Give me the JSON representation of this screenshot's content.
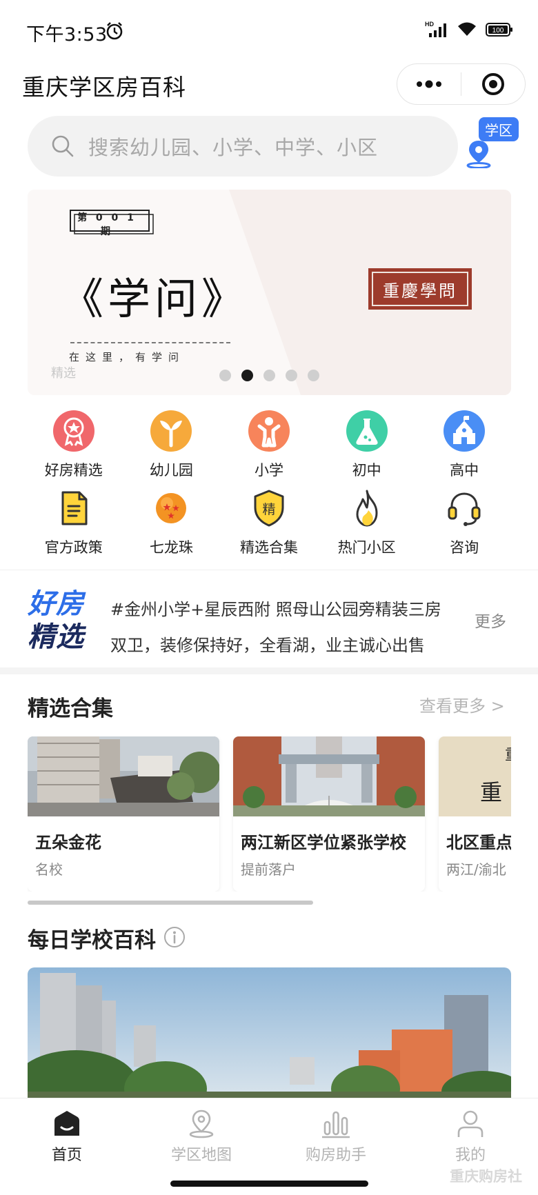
{
  "status_bar": {
    "time": "下午3:53",
    "network_label": "HD",
    "battery": "100"
  },
  "header": {
    "title": "重庆学区房百科"
  },
  "search": {
    "placeholder": "搜索幼儿园、小学、中学、小区",
    "district_badge": "学区"
  },
  "banner": {
    "issue": "第 0 0 1 期",
    "title": "《学问》",
    "subtitle": "在这里，有学问",
    "tag": "精选",
    "seal": "重慶學問",
    "dots_total": 5,
    "active_dot": 2
  },
  "categories": [
    {
      "label": "好房精选",
      "icon": "medal-icon"
    },
    {
      "label": "幼儿园",
      "icon": "sprout-icon"
    },
    {
      "label": "小学",
      "icon": "child-icon"
    },
    {
      "label": "初中",
      "icon": "flask-icon"
    },
    {
      "label": "高中",
      "icon": "school-icon"
    },
    {
      "label": "官方政策",
      "icon": "document-icon"
    },
    {
      "label": "七龙珠",
      "icon": "dragon-ball-icon"
    },
    {
      "label": "精选合集",
      "icon": "shield-icon"
    },
    {
      "label": "热门小区",
      "icon": "flame-icon"
    },
    {
      "label": "咨询",
      "icon": "headset-icon"
    }
  ],
  "featured": {
    "logo_line1": "好房",
    "logo_line2": "精选",
    "line1": "#金州小学+星辰西附 照母山公园旁精装三房",
    "line2": "双卫，装修保持好，全看湖，业主诚心出售",
    "more": "更多"
  },
  "collection": {
    "title": "精选合集",
    "see_more": "查看更多 >",
    "cards": [
      {
        "title": "五朵金花",
        "subtitle": "名校"
      },
      {
        "title": "两江新区学位紧张学校",
        "subtitle": "提前落户"
      },
      {
        "title": "北区重点",
        "subtitle": "两江/渝北"
      }
    ],
    "scroll_fraction": 0.59
  },
  "daily": {
    "title": "每日学校百科"
  },
  "tabbar": {
    "tabs": [
      {
        "label": "首页",
        "icon": "home-icon",
        "active": true
      },
      {
        "label": "学区地图",
        "icon": "map-pin-icon",
        "active": false
      },
      {
        "label": "购房助手",
        "icon": "bar-chart-icon",
        "active": false
      },
      {
        "label": "我的",
        "icon": "user-icon",
        "active": false
      }
    ]
  },
  "watermark": "重庆购房社",
  "colors": {
    "accent_blue": "#3d7cf5",
    "seal_red": "#9d3b2c",
    "featured_blue": "#2d6ee8",
    "featured_navy": "#1b2a5e"
  }
}
